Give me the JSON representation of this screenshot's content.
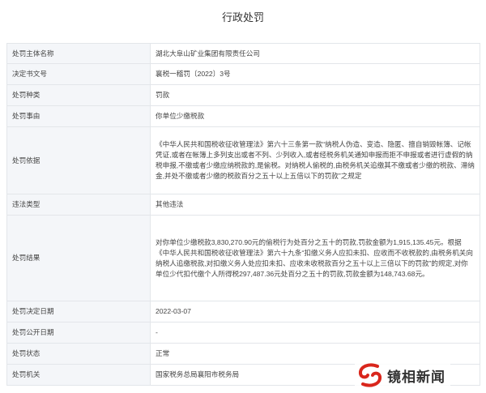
{
  "page": {
    "title": "行政处罚"
  },
  "rows": [
    {
      "label": "处罚主体名称",
      "value": "湖北大阜山矿业集团有限责任公司"
    },
    {
      "label": "决定书文号",
      "value": "襄税一稽罚〔2022〕3号"
    },
    {
      "label": "处罚种类",
      "value": "罚款"
    },
    {
      "label": "处罚事由",
      "value": "你单位少缴税款"
    },
    {
      "label": "处罚依据",
      "value": "《中华人民共和国税收征收管理法》第六十三条第一款“纳税人伪造、变造、隐匿、擅自销毁帐簿、记帐凭证,或者在帐簿上多列支出或者不列、少列收入,或者经税务机关通知申报而拒不申报或者进行虚假的纳税申报,不缴或者少缴应纳税款的,是偷税。对纳税人偷税的,由税务机关追缴其不缴或者少缴的税款、滞纳金,并处不缴或者少缴的税款百分之五十以上五倍以下的罚款”之规定"
    },
    {
      "label": "违法类型",
      "value": "其他违法"
    },
    {
      "label": "处罚结果",
      "value": "对你单位少缴税款3,830,270.90元的偷税行为处百分之五十的罚款,罚款金额为1,915,135.45元。根据《中华人民共和国税收征收管理法》第六十九条“扣缴义务人应扣未扣、应收而不收税款的,由税务机关向纳税人追缴税款,对扣缴义务人处应扣未扣、应收未收税款百分之五十以上三倍以下的罚款”的规定,对你单位少代扣代缴个人所得税297,487.36元处百分之五十的罚款,罚款金额为148,743.68元。"
    },
    {
      "label": "处罚决定日期",
      "value": "2022-03-07"
    },
    {
      "label": "处罚公开日期",
      "value": "-"
    },
    {
      "label": "处罚状态",
      "value": "正常"
    },
    {
      "label": "处罚机关",
      "value": "国家税务总局襄阳市税务局"
    }
  ],
  "watermark": {
    "text": "镜相新闻",
    "icon": "logo-icon",
    "accent": "#d9261c"
  }
}
